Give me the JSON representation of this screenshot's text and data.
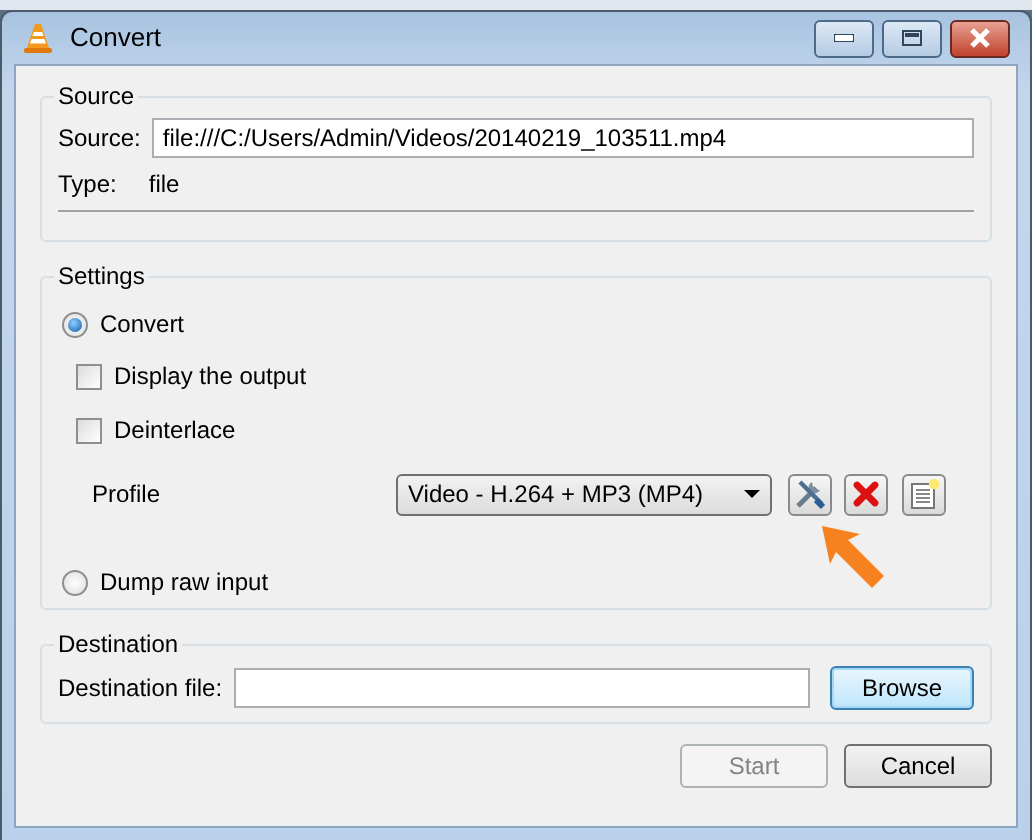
{
  "window": {
    "title": "Convert"
  },
  "source": {
    "title": "Source",
    "source_label": "Source:",
    "source_value": "file:///C:/Users/Admin/Videos/20140219_103511.mp4",
    "type_label": "Type:",
    "type_value": "file"
  },
  "settings": {
    "title": "Settings",
    "convert_option": {
      "label": "Convert",
      "selected": true
    },
    "sub_options": [
      {
        "label": "Display the output",
        "checked": false
      },
      {
        "label": "Deinterlace",
        "checked": false
      }
    ],
    "profile": {
      "label": "Profile",
      "value": "Video - H.264 + MP3 (MP4)"
    },
    "dump_option": {
      "label": "Dump raw input",
      "selected": false
    }
  },
  "destination": {
    "title": "Destination",
    "label": "Destination file:",
    "browse_button": "Browse"
  },
  "buttons": [
    {
      "label": "Start",
      "disabled": true
    },
    {
      "label": "Cancel",
      "disabled": false
    }
  ]
}
